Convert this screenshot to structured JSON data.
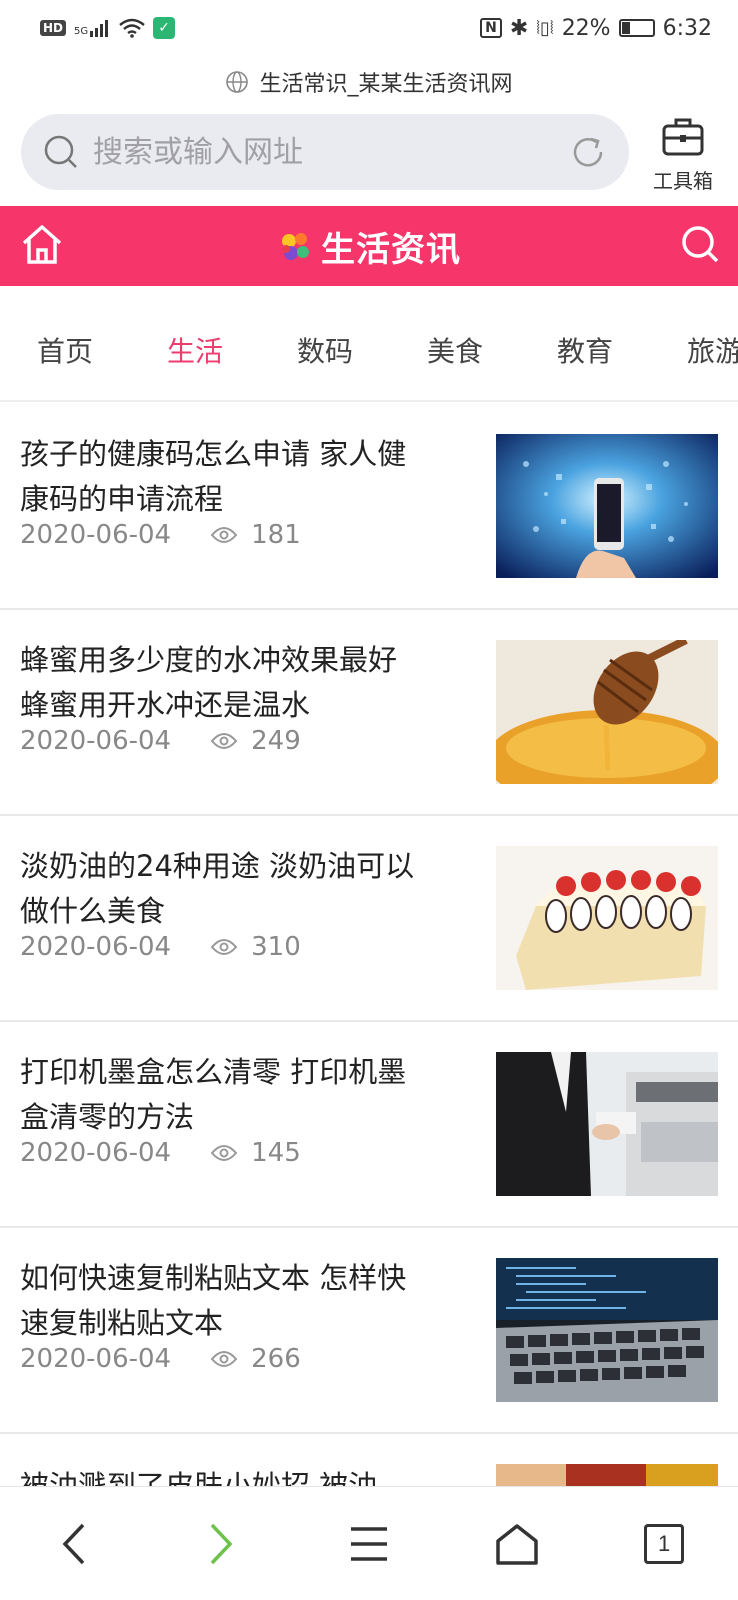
{
  "status_bar": {
    "hd": "HD",
    "network": "5G",
    "battery": "22%",
    "time": "6:32"
  },
  "page_title": "生活常识_某某生活资讯网",
  "address_bar": {
    "placeholder": "搜索或输入网址"
  },
  "toolbox_label": "工具箱",
  "site": {
    "brand": "生活资讯",
    "accent_color": "#f6356b"
  },
  "tabs": [
    {
      "label": "首页",
      "active": false
    },
    {
      "label": "生活",
      "active": true
    },
    {
      "label": "数码",
      "active": false
    },
    {
      "label": "美食",
      "active": false
    },
    {
      "label": "教育",
      "active": false
    },
    {
      "label": "旅游",
      "active": false
    }
  ],
  "articles": [
    {
      "title": "孩子的健康码怎么申请 家人健康码的申请流程",
      "date": "2020-06-04",
      "views": "181",
      "thumb": "phone-digital-image"
    },
    {
      "title": "蜂蜜用多少度的水冲效果最好 蜂蜜用开水冲还是温水",
      "date": "2020-06-04",
      "views": "249",
      "thumb": "honey-dipper-image"
    },
    {
      "title": "淡奶油的24种用途 淡奶油可以做什么美食",
      "date": "2020-06-04",
      "views": "310",
      "thumb": "strawberry-cake-image"
    },
    {
      "title": "打印机墨盒怎么清零 打印机墨盒清零的方法",
      "date": "2020-06-04",
      "views": "145",
      "thumb": "office-printer-image"
    },
    {
      "title": "如何快速复制粘贴文本 怎样快速复制粘贴文本",
      "date": "2020-06-04",
      "views": "266",
      "thumb": "laptop-keyboard-image"
    }
  ],
  "partial_article": {
    "title": "被油溅到了皮肤小妙招 被油"
  },
  "bottom_nav": {
    "tab_count": "1"
  }
}
